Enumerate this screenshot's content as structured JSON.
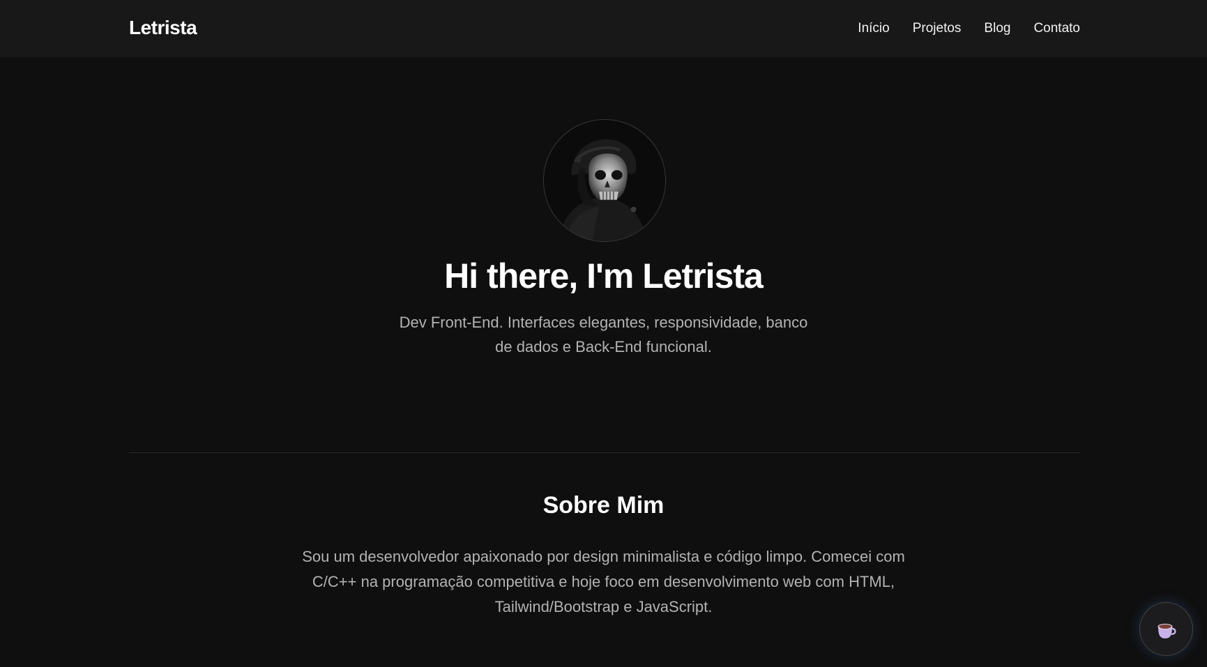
{
  "header": {
    "brand": "Letrista",
    "nav": [
      {
        "label": "Início"
      },
      {
        "label": "Projetos"
      },
      {
        "label": "Blog"
      },
      {
        "label": "Contato"
      }
    ]
  },
  "hero": {
    "title": "Hi there, I'm Letrista",
    "subtitle": "Dev Front-End. Interfaces elegantes, responsividade, banco de dados e Back-End funcional."
  },
  "about": {
    "title": "Sobre Mim",
    "text": "Sou um desenvolvedor apaixonado por design minimalista e código limpo. Comecei com C/C++ na programação competitiva e hoje foco em desenvolvimento web com HTML, Tailwind/Bootstrap e JavaScript."
  },
  "icons": {
    "avatar": "skull-mask-soldier-avatar",
    "floating_button": "coffee-cup-icon"
  },
  "colors": {
    "background": "#0f0f0f",
    "navbar": "#181818",
    "text": "#ffffff",
    "muted_text": "#b3b3b3",
    "divider": "#2a2a2a"
  }
}
